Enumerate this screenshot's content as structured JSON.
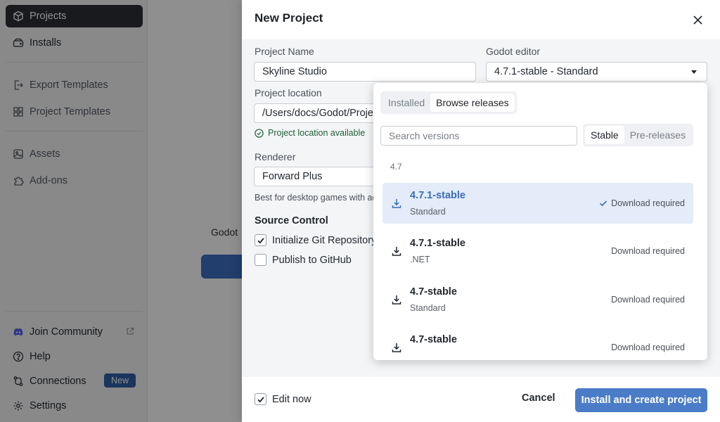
{
  "sidebar": {
    "items": [
      {
        "label": "Projects",
        "icon": "box-icon"
      },
      {
        "label": "Installs",
        "icon": "drive-icon"
      },
      {
        "label": "Export Templates",
        "icon": "export-icon"
      },
      {
        "label": "Project Templates",
        "icon": "template-icon"
      },
      {
        "label": "Assets",
        "icon": "image-icon"
      },
      {
        "label": "Add-ons",
        "icon": "puzzle-icon"
      }
    ],
    "footer": [
      {
        "label": "Join Community",
        "icon": "discord-icon"
      },
      {
        "label": "Help",
        "icon": "help-icon"
      },
      {
        "label": "Connections",
        "icon": "connections-icon",
        "badge": "New"
      },
      {
        "label": "Settings",
        "icon": "gear-icon"
      }
    ]
  },
  "background": {
    "text": "Godot"
  },
  "drawer": {
    "title": "New Project",
    "project_name": {
      "label": "Project Name",
      "value": "Skyline Studio"
    },
    "godot_editor": {
      "label": "Godot editor",
      "value": "4.7.1-stable - Standard"
    },
    "project_location": {
      "label": "Project location",
      "value": "/Users/docs/Godot/Projects/Skyline Studio",
      "status": "Project location available"
    },
    "renderer": {
      "label": "Renderer",
      "value": "Forward Plus",
      "help": "Best for desktop games with advanced graphics"
    },
    "source_control": {
      "title": "Source Control",
      "init_git": {
        "label": "Initialize Git Repository",
        "checked": true
      },
      "publish_github": {
        "label": "Publish to GitHub",
        "checked": false
      }
    },
    "footer": {
      "edit_now": "Edit now",
      "cancel": "Cancel",
      "primary": "Install and create project"
    }
  },
  "version_picker": {
    "tabs": [
      "Installed",
      "Browse releases"
    ],
    "active_tab": "Browse releases",
    "search_placeholder": "Search versions",
    "channels": [
      "Stable",
      "Pre-releases"
    ],
    "active_channel": "Stable",
    "group": "4.7",
    "versions": [
      {
        "name": "4.7.1-stable",
        "flavor": "Standard",
        "status": "Download required",
        "selected": true
      },
      {
        "name": "4.7.1-stable",
        "flavor": ".NET",
        "status": "Download required",
        "selected": false
      },
      {
        "name": "4.7-stable",
        "flavor": "Standard",
        "status": "Download required",
        "selected": false
      },
      {
        "name": "4.7-stable",
        "flavor": "",
        "status": "Download required",
        "selected": false
      }
    ]
  },
  "colors": {
    "accent": "#4a7cc7",
    "selected_row": "#e3ecf8",
    "badge": "#2f5fa8",
    "success": "#1d5f35"
  }
}
